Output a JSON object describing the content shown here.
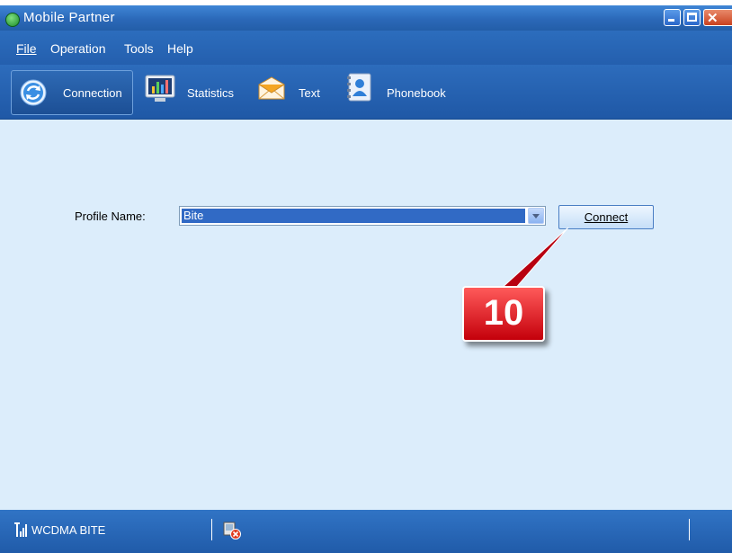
{
  "window": {
    "title": "Mobile Partner"
  },
  "menu": [
    {
      "label": "File"
    },
    {
      "label": "Operation"
    },
    {
      "label": "Tools"
    },
    {
      "label": "Help"
    }
  ],
  "toolbar": {
    "tabs": [
      {
        "label": "Connection",
        "icon": "connection-icon",
        "active": true
      },
      {
        "label": "Statistics",
        "icon": "statistics-icon"
      },
      {
        "label": "Text",
        "icon": "envelope-icon"
      },
      {
        "label": "Phonebook",
        "icon": "phonebook-icon"
      }
    ]
  },
  "connection": {
    "profile_label": "Profile Name:",
    "profile_value": "Bite",
    "connect_label": "Connect"
  },
  "annotation": {
    "callout_number": "10"
  },
  "status": {
    "network": "WCDMA BITE"
  },
  "colors": {
    "accent": "#2b68b8",
    "content_bg": "#dcedfb",
    "callout": "#e0141e"
  }
}
